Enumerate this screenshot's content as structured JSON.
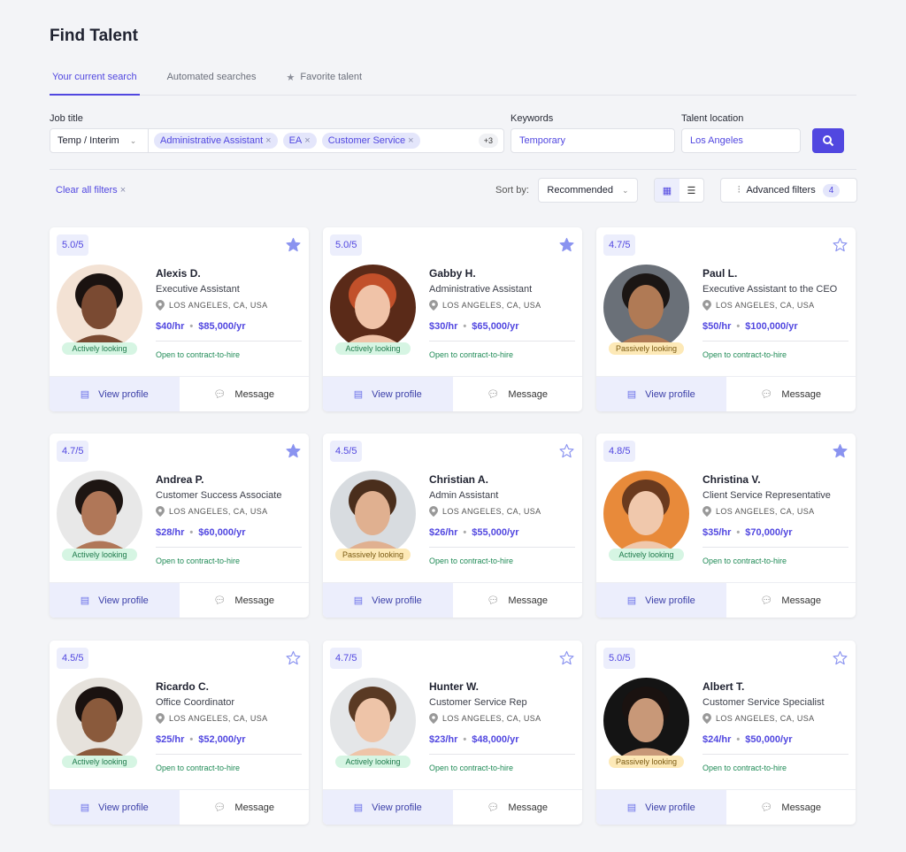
{
  "page": {
    "title": "Find Talent"
  },
  "tabs": [
    {
      "label": "Your current search"
    },
    {
      "label": "Automated searches"
    },
    {
      "label": "Favorite talent"
    }
  ],
  "search": {
    "job_title_label": "Job title",
    "job_type": "Temp / Interim",
    "chips": [
      "Administrative Assistant",
      "EA",
      "Customer Service"
    ],
    "more": "+3",
    "keywords_label": "Keywords",
    "keywords_value": "Temporary",
    "location_label": "Talent location",
    "location_value": "Los Angeles"
  },
  "filters": {
    "clear_all": "Clear all filters",
    "sort_label": "Sort by:",
    "sort_value": "Recommended",
    "advanced": "Advanced filters",
    "advanced_count": "4"
  },
  "colors": {
    "accent": "#5147e0",
    "active": "#d6f5e3",
    "passive": "#fde9b7"
  },
  "card_labels": {
    "view": "View profile",
    "message": "Message",
    "open": "Open to contract-to-hire",
    "location": "LOS ANGELES, CA, USA"
  },
  "talent": [
    {
      "rating": "5.0/5",
      "favorite": true,
      "name": "Alexis D.",
      "role": "Executive Assistant",
      "hourly": "$40/hr",
      "yearly": "$85,000/yr",
      "status": "Actively looking",
      "skin": "#7a4a32",
      "hair": "#1a1210",
      "bg": "#f3e2d4"
    },
    {
      "rating": "5.0/5",
      "favorite": true,
      "name": "Gabby H.",
      "role": "Administrative Assistant",
      "hourly": "$30/hr",
      "yearly": "$65,000/yr",
      "status": "Actively looking",
      "skin": "#f0c3a8",
      "hair": "#c2502a",
      "bg": "#5a2a18"
    },
    {
      "rating": "4.7/5",
      "favorite": false,
      "name": "Paul L.",
      "role": "Executive Assistant to the CEO",
      "hourly": "$50/hr",
      "yearly": "$100,000/yr",
      "status": "Passively looking",
      "skin": "#b07a55",
      "hair": "#1b1614",
      "bg": "#6a7078"
    },
    {
      "rating": "4.7/5",
      "favorite": true,
      "name": "Andrea P.",
      "role": "Customer Success Associate",
      "hourly": "$28/hr",
      "yearly": "$60,000/yr",
      "status": "Actively looking",
      "skin": "#b07758",
      "hair": "#1d1512",
      "bg": "#e8e8e8"
    },
    {
      "rating": "4.5/5",
      "favorite": false,
      "name": "Christian A.",
      "role": "Admin Assistant",
      "hourly": "$26/hr",
      "yearly": "$55,000/yr",
      "status": "Passively looking",
      "skin": "#e0b090",
      "hair": "#4a2e1c",
      "bg": "#d8dce0"
    },
    {
      "rating": "4.8/5",
      "favorite": true,
      "name": "Christina V.",
      "role": "Client Service Representative",
      "hourly": "$35/hr",
      "yearly": "$70,000/yr",
      "status": "Actively looking",
      "skin": "#f0c8ac",
      "hair": "#6a3a1e",
      "bg": "#e88a3a"
    },
    {
      "rating": "4.5/5",
      "favorite": false,
      "name": "Ricardo C.",
      "role": "Office Coordinator",
      "hourly": "$25/hr",
      "yearly": "$52,000/yr",
      "status": "Actively looking",
      "skin": "#8a5a3c",
      "hair": "#1a1210",
      "bg": "#e6e2dc"
    },
    {
      "rating": "4.7/5",
      "favorite": false,
      "name": "Hunter W.",
      "role": "Customer Service Rep",
      "hourly": "$23/hr",
      "yearly": "$48,000/yr",
      "status": "Actively looking",
      "skin": "#eec4a8",
      "hair": "#5a3a24",
      "bg": "#e4e6e8"
    },
    {
      "rating": "5.0/5",
      "favorite": false,
      "name": "Albert T.",
      "role": "Customer Service Specialist",
      "hourly": "$24/hr",
      "yearly": "$50,000/yr",
      "status": "Passively looking",
      "skin": "#c89878",
      "hair": "#1a1210",
      "bg": "#141414"
    }
  ]
}
